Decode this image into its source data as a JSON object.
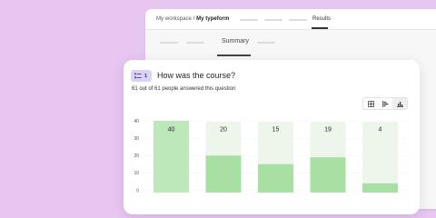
{
  "back_window": {
    "breadcrumb_workspace": "My workspace",
    "breadcrumb_sep": " / ",
    "breadcrumb_form": "My typeform",
    "tab_results": "Results",
    "tab_summary": "Summary"
  },
  "question": {
    "number": "1",
    "title": "How was the course?",
    "answered_text": "61 out of 61 people answered this question"
  },
  "view_toggle": [
    "table-view-icon",
    "horizontal-bar-view-icon",
    "vertical-bar-view-icon"
  ],
  "colors": {
    "background": "#e7c6f2",
    "bar_fill": "#a8e0a4",
    "bar_fill_top": "#bde8b9",
    "bar_track": "#eef6ec",
    "badge": "#dcd1f7"
  },
  "chart_data": {
    "type": "bar",
    "categories": [
      "",
      "",
      "",
      "",
      ""
    ],
    "values": [
      40,
      20,
      15,
      19,
      4
    ],
    "value_labels": [
      "40",
      "20",
      "15",
      "19",
      "4"
    ],
    "yticks": [
      0,
      10,
      20,
      30,
      40
    ],
    "ylim": [
      0,
      40
    ],
    "max": 40,
    "title": "",
    "xlabel": "",
    "ylabel": ""
  }
}
